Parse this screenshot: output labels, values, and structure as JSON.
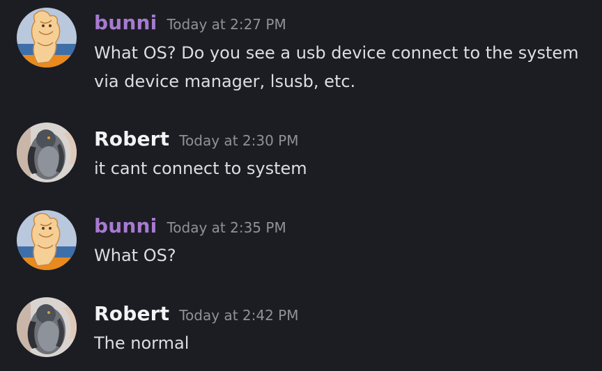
{
  "colors": {
    "background": "#1c1d22",
    "bunni_name": "#a77ad1",
    "robert_name": "#f2f3f5",
    "timestamp": "#8f929b",
    "message_text": "#dcdee2"
  },
  "messages": [
    {
      "author": "bunni",
      "avatar_icon": "bunny-drawing-avatar-icon",
      "timestamp": "Today at 2:27 PM",
      "text": "What OS? Do you see a usb device connect to the system via device manager, lsusb, etc."
    },
    {
      "author": "Robert",
      "avatar_icon": "pigeon-photo-avatar-icon",
      "timestamp": "Today at 2:30 PM",
      "text": "it cant connect to system"
    },
    {
      "author": "bunni",
      "avatar_icon": "bunny-drawing-avatar-icon",
      "timestamp": "Today at 2:35 PM",
      "text": "What OS?"
    },
    {
      "author": "Robert",
      "avatar_icon": "pigeon-photo-avatar-icon",
      "timestamp": "Today at 2:42 PM",
      "text": "The normal"
    }
  ]
}
